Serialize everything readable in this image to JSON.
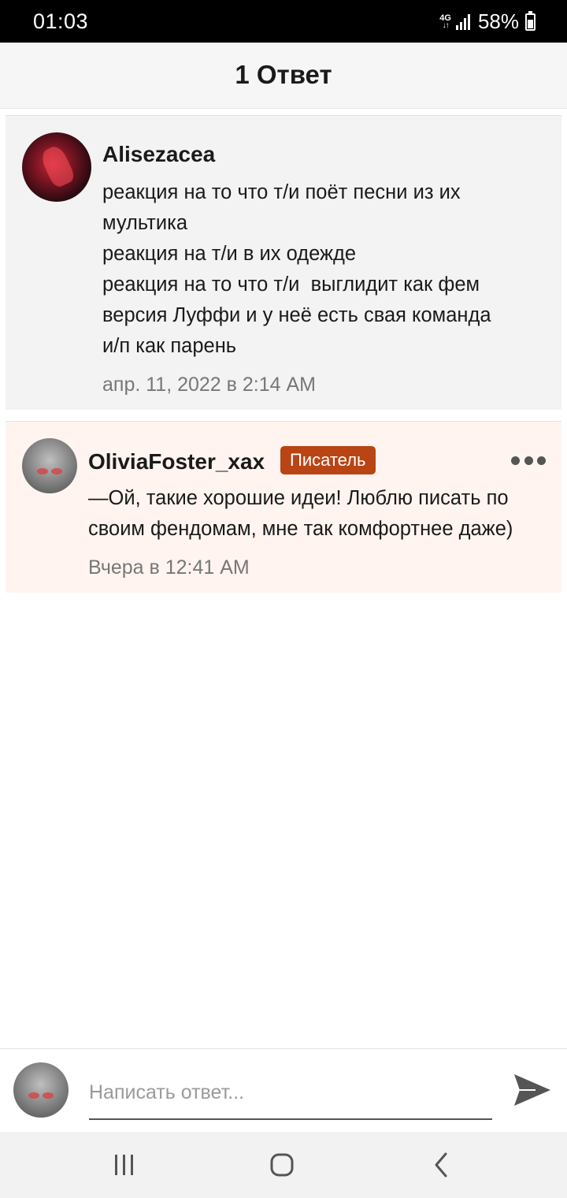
{
  "status_bar": {
    "time": "01:03",
    "network": "4G",
    "network_arrows": "↓↑",
    "battery": "58%"
  },
  "header": {
    "title": "1 Ответ"
  },
  "comment": {
    "author": "Alisezacea",
    "lines": [
      "реакция на то что т/и поёт песни из их",
      "мультика",
      "реакция на т/и в их одежде",
      "реакция на то что т/и  выглидит как фем",
      "версия Луффи и у неё есть свая команда",
      "и/п как парень"
    ],
    "timestamp": "апр. 11, 2022 в 2:14 AM"
  },
  "reply": {
    "author": "OliviaFoster_xax",
    "role_badge": "Писатель",
    "lines": [
      "—Ой, такие хорошие идеи! Люблю писать по",
      "своим фендомам, мне так комфортнее даже)"
    ],
    "timestamp": "Вчера в 12:41 AM"
  },
  "reply_bar": {
    "placeholder": "Написать ответ..."
  },
  "icons": {
    "more": "more-dots-icon",
    "send": "send-icon",
    "nav_recents": "recents-icon",
    "nav_home": "home-icon",
    "nav_back": "back-icon"
  },
  "colors": {
    "header_bg": "#f6f6f6",
    "comment_bg": "#f3f3f3",
    "reply_bg": "#fff4f0",
    "badge_bg": "#b94514"
  }
}
